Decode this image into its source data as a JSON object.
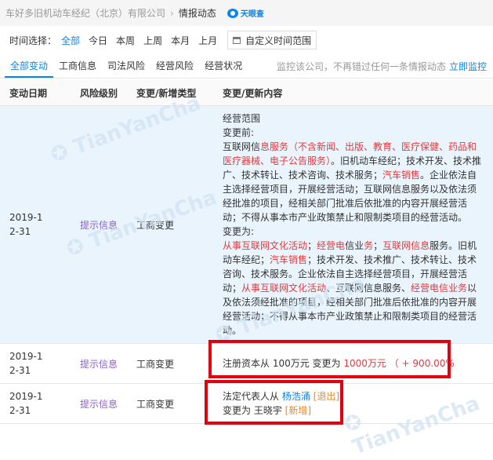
{
  "breadcrumb": {
    "company": "车好多旧机动车经纪（北京）有限公司",
    "current": "情报动态",
    "brand": "天眼查"
  },
  "time_filter": {
    "label": "时间选择：",
    "options": [
      "全部",
      "今日",
      "本周",
      "上周",
      "本月",
      "上月"
    ],
    "active": "全部",
    "custom_label": "自定义时间范围"
  },
  "tabs": {
    "items": [
      "全部变动",
      "工商信息",
      "司法风险",
      "经营风险",
      "经营状况"
    ],
    "active": "全部变动",
    "notice": "监控该公司，不再错过任何一条情报动态",
    "monitor_link": "立即监控"
  },
  "table": {
    "headers": [
      "变动日期",
      "风险级别",
      "变更/新增类型",
      "变更/更新内容"
    ],
    "rows": [
      {
        "date": "2019-12-31",
        "risk": "提示信息",
        "type": "工商变更",
        "content_title": "经营范围",
        "before_label": "变更前:",
        "before_segments": [
          {
            "t": "互联网信",
            "c": ""
          },
          {
            "t": "息服务",
            "c": "red"
          },
          {
            "t": "（不含新闻、出版、教育、医疗保健、药品和医疗器械、电子公告服务）",
            "c": "red"
          },
          {
            "t": "。旧机动车经纪；技术开发、技术推广、技术转让、技术咨询、技术服务；",
            "c": ""
          },
          {
            "t": "汽车销售",
            "c": "red"
          },
          {
            "t": "。企业依法自主选择经营项目，开展经营活动；互联网信息服务以及依法须经批准的项目，经相关部门批准后依批准的内容开展经营活动；不得从事本市产业政策禁止和限制类项目的经营活动。",
            "c": ""
          }
        ],
        "after_label": "变更为:",
        "after_segments": [
          {
            "t": "从事互联网",
            "c": "red"
          },
          {
            "t": "文化活动",
            "c": "red"
          },
          {
            "t": "；",
            "c": ""
          },
          {
            "t": "经营电",
            "c": "red"
          },
          {
            "t": "信业",
            "c": ""
          },
          {
            "t": "务",
            "c": "red"
          },
          {
            "t": "；",
            "c": ""
          },
          {
            "t": "互联网信息",
            "c": "red"
          },
          {
            "t": "服务。旧机动车经纪；",
            "c": ""
          },
          {
            "t": "汽车销售",
            "c": "red"
          },
          {
            "t": "；技术开发、技术推广、技术转让、技术咨询、技术服务。企业依法自主选择经营项目，开展经营活动；",
            "c": ""
          },
          {
            "t": "从事互联网文化活动",
            "c": "red"
          },
          {
            "t": "、互联网信息服务、",
            "c": ""
          },
          {
            "t": "经营电信业务",
            "c": "red"
          },
          {
            "t": "以及依法须经批准的项目，经相关部门批准后依批准的内容开展经营活动；不得从事本市产业政策禁止和限制类项目的经营活动。",
            "c": ""
          }
        ]
      },
      {
        "date": "2019-12-31",
        "risk": "提示信息",
        "type": "工商变更",
        "capital_prefix": "注册资本从 100万元 变更为 ",
        "capital_new": "1000万元",
        "capital_change": "（ + 900.00%"
      },
      {
        "date": "2019-12-31",
        "risk": "提示信息",
        "type": "工商变更",
        "legal_prefix": "法定代表人从 ",
        "legal_old": "杨浩涌",
        "legal_old_tag": "[退出]",
        "legal_mid": "变更为 王晓宇 ",
        "legal_new_tag": "[新增]"
      }
    ]
  },
  "colors": {
    "accent": "#0b84ee",
    "red": "#e4393c",
    "risk_purple": "#8b60c9",
    "highlight_box": "#e2000f"
  }
}
